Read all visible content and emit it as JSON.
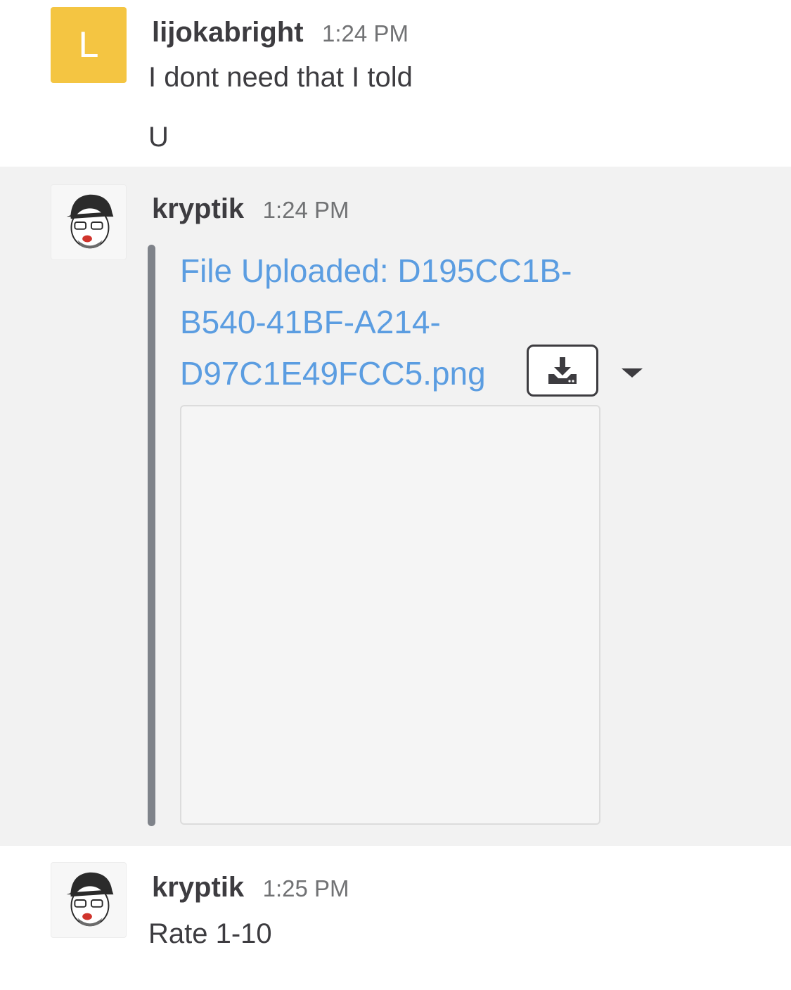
{
  "messages": [
    {
      "sender": "lijokabright",
      "time": "1:24 PM",
      "avatar_letter": "L",
      "lines": [
        "I dont need that I told",
        "U"
      ]
    },
    {
      "sender": "kryptik",
      "time": "1:24 PM",
      "avatar_icon": "user-photo-avatar",
      "file": {
        "title": "File Uploaded: D195CC1B-B540-41BF-A214-D97C1E49FCC5.png",
        "download_icon": "download-icon",
        "menu_icon": "caret-down-icon"
      }
    },
    {
      "sender": "kryptik",
      "time": "1:25 PM",
      "avatar_icon": "user-photo-avatar",
      "lines": [
        "Rate 1-10"
      ]
    }
  ],
  "colors": {
    "link": "#5b9de1",
    "avatar_letter_bg": "#f4c542",
    "attachment_bar": "#7f838a",
    "highlight_bg": "#f2f2f2"
  }
}
